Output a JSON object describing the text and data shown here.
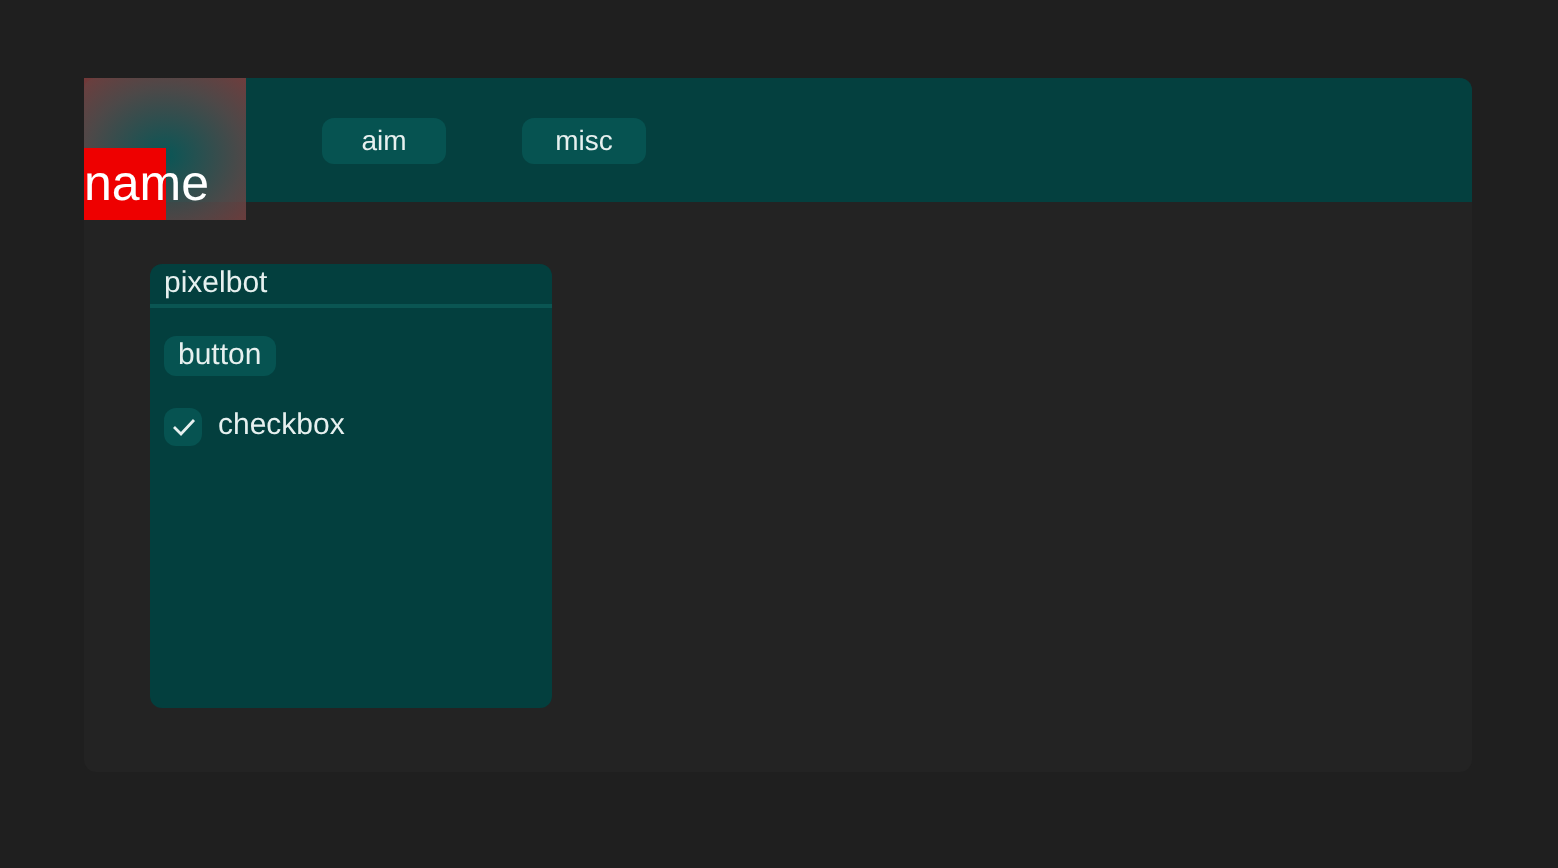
{
  "logo": {
    "text": "name"
  },
  "tabs": [
    {
      "label": "aim",
      "selected": false
    },
    {
      "label": "misc",
      "selected": false
    }
  ],
  "window": {
    "title": "pixelbot",
    "controls": [
      {
        "kind": "button",
        "label": "button"
      },
      {
        "kind": "checkbox",
        "label": "checkbox",
        "checked": true
      }
    ]
  }
}
